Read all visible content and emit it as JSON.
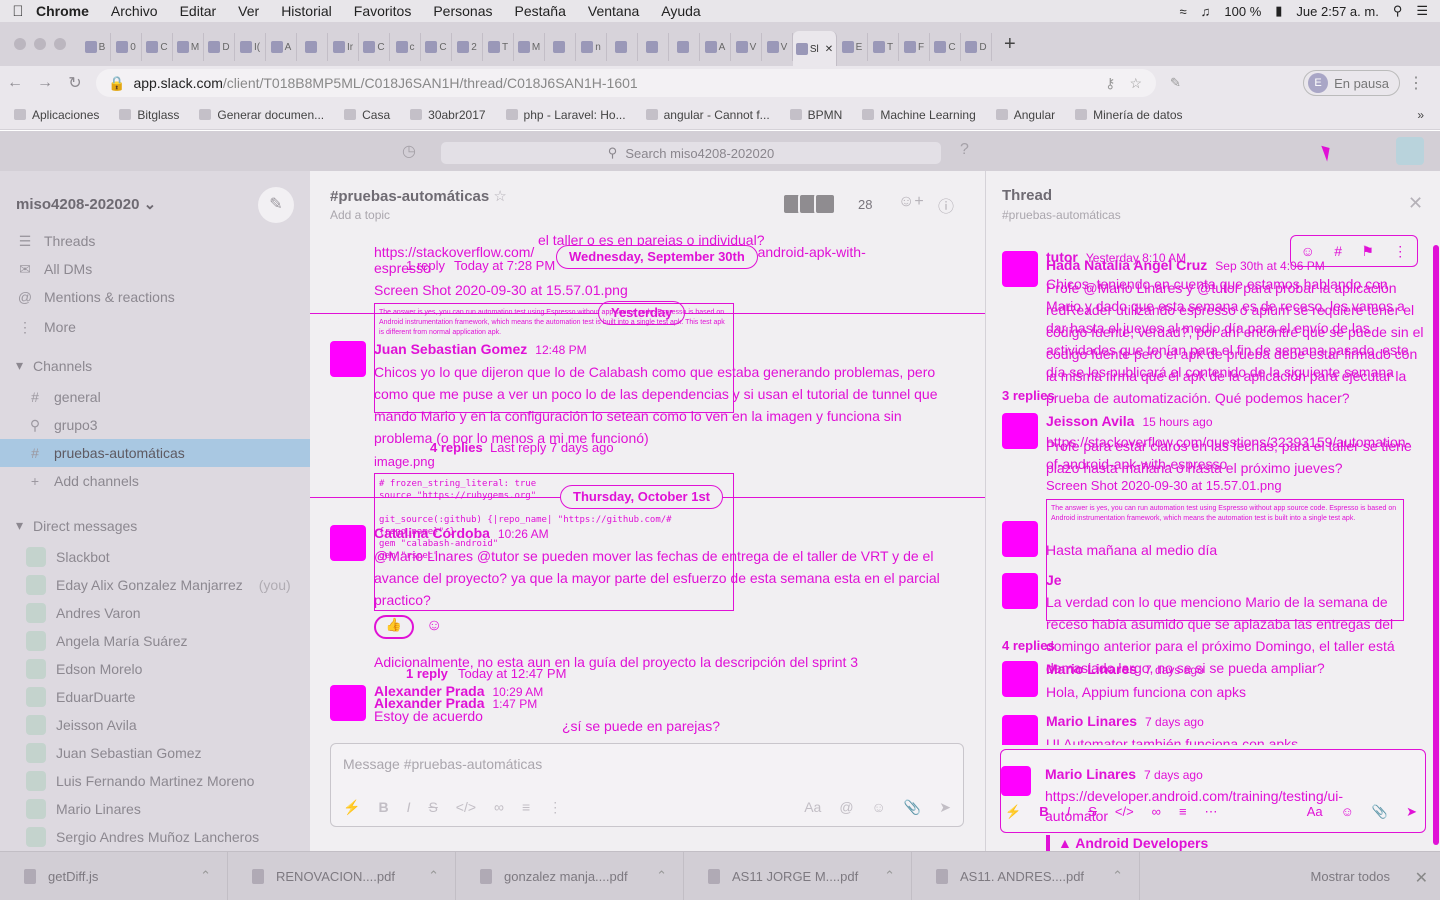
{
  "menubar": {
    "app": "Chrome",
    "items": [
      "Archivo",
      "Editar",
      "Ver",
      "Historial",
      "Favoritos",
      "Personas",
      "Pestaña",
      "Ventana",
      "Ayuda"
    ],
    "battery": "100 %",
    "clock": "Jue 2:57 a. m."
  },
  "tabs": [
    "B",
    "0",
    "C",
    "M",
    "D",
    "I(",
    "A",
    "",
    "Ir",
    "C",
    "c",
    "C",
    "2",
    "T",
    "M",
    "",
    "n",
    "",
    "",
    "",
    "A",
    "V",
    "V",
    "Sl",
    "E",
    "T",
    "F",
    "C",
    "D"
  ],
  "active_tab_index": 23,
  "toolbar": {
    "url_host": "app.slack.com",
    "url_path": "/client/T018B8MP5ML/C018J6SAN1H/thread/C018J6SAN1H-1601",
    "profile_initial": "E",
    "profile_status": "En pausa"
  },
  "bookmarks": [
    "Aplicaciones",
    "Bitglass",
    "Generar documen...",
    "Casa",
    "30abr2017",
    "php - Laravel: Ho...",
    "angular - Cannot f...",
    "BPMN",
    "Machine Learning",
    "Angular",
    "Minería de datos"
  ],
  "slack": {
    "search_placeholder": "Search miso4208-202020"
  },
  "sidebar": {
    "workspace": "miso4208-202020",
    "nav": [
      "Threads",
      "All DMs",
      "Mentions & reactions",
      "More"
    ],
    "channels_header": "Channels",
    "channels": [
      "general",
      "grupo3",
      "pruebas-automáticas"
    ],
    "add_channels": "Add channels",
    "dm_header": "Direct messages",
    "dms": [
      "Slackbot",
      "Eday Alix Gonzalez Manjarrez",
      "Andres Varon",
      "Angela María Suárez",
      "Edson Morelo",
      "EduarDuarte",
      "Jeisson Avila",
      "Juan Sebastian Gomez",
      "Luis Fernando Martinez Moreno",
      "Mario Linares",
      "Sergio Andres Muñoz Lancheros"
    ],
    "you_label": "(you)"
  },
  "channel": {
    "title": "#pruebas-automáticas",
    "topic": "Add a topic",
    "member_count": "28",
    "date_dividers": [
      "Wednesday, September 30th",
      "Yesterday",
      "Thursday, October 1st"
    ],
    "lines": {
      "l1": "el taller o es en parejas o individual?",
      "l2": "https://stackoverflow.com/",
      "l2b": "tion-of-android-apk-with-",
      "l3": "espresso",
      "reply1": "1 reply",
      "reply1time": "Today at 7:28 PM",
      "file1": "Screen Shot 2020-09-30 at 15.57.01.png",
      "jsg_name": "Juan Sebastian Gomez",
      "jsg_time": "12:48 PM",
      "jsg_text": "Chicos yo lo que dijeron que lo de Calabash como que estaba generando problemas, pero como que me puse a ver un poco lo de las dependencias y si usan el tutorial de tunnel que mando Mario y en la configuración lo setean como lo ven en la imagen y funciona sin problema (o por lo menos a mi me funcionó)",
      "replies4": "4 replies",
      "replies4time": "Last reply 7 days ago",
      "image_png": "image.png",
      "cat_name": "Catalina Córdoba",
      "cat_time": "10:26 AM",
      "cat_text": "@Mario Linares @tutor se pueden mover las fechas de entrega de el taller de VRT y de el avance del proyecto? ya que la mayor parte del esfuerzo de esta semana esta en el parcial practico?",
      "adic": "Adicionalmente, no esta aun en la guía del proyecto la descripción del sprint 3",
      "reply2": "1 reply",
      "reply2time": "Today at 12:47 PM",
      "ap_name": "Alexander Prada",
      "ap_time": "10:29 AM",
      "ap_name2": "Alexander Prada",
      "ap_time2": "1:47 PM",
      "ap_text": "Estoy de acuerdo",
      "pareja": "¿sí se puede en parejas?"
    },
    "composer_placeholder": "Message #pruebas-automáticas"
  },
  "thread": {
    "title": "Thread",
    "channel": "#pruebas-automáticas",
    "author": "Hada Natalia Angel Cruz",
    "author_time": "Sep 30th at 4:06 PM",
    "tutor": "tutor",
    "tutor_time": "Yesterday 8:10 AM",
    "t1": "Profe @Mario Linares y @tutor para probar la aplicación redReader utilizando espresso o apium se requiere tener el código fuente, verdad?, por ahí encontré que se puede sin el código fuente pero el apk de prueba debe estar firmado con la misma firma que el apk de la aplicación para ejecutar la prueba de automatización. Qué podemos hacer?",
    "ghost": "Chicos, teniendo en cuenta que estamos hablando con Mario y dado que esta semana es de receso, les vamos a dar hasta el jueves al medio día para el envío de las actividades que tenían para el fin de semana pasado, este día se les publicará el contenido de la siguiente semana",
    "replies3": "3 replies",
    "ja_name": "Jeisson Avila",
    "ja_time": "15 hours ago",
    "ja_link": "https://stackoverflow.com/questions/32393159/automation-of-android-apk-with-espresso",
    "ghost2": "Profe para estar claros en las fechas, para el taller se tiene plazo hasta mañana o hasta el próximo jueves?",
    "file": "Screen Shot 2020-09-30 at 15.57.01.png",
    "hasta": "Hasta mañana al medio día",
    "jeisson2": "Je",
    "verdad": "La verdad con lo que menciono Mario de la semana de receso había asumido que se aplazaba las entregas del domingo anterior para el próximo Domingo, el taller está demasiado largo, no se si se pueda ampliar?",
    "replies4": "4 replies",
    "ml_name": "Mario Linares",
    "ml_time": "7 days ago",
    "ml_text1": "Hola, Appium funciona con  apks",
    "ml_text2": "UI Automator también funciona con apks",
    "ml_link": "https://developer.android.com/training/testing/ui-automator",
    "android": "Android Developers"
  },
  "downloads": {
    "files": [
      "getDiff.js",
      "RENOVACION....pdf",
      "gonzalez manja....pdf",
      "AS11 JORGE M....pdf",
      "AS11. ANDRES....pdf"
    ],
    "show_all": "Mostrar todos"
  },
  "colors": {
    "accent": "#e011d6",
    "selected_channel": "#a9c8e2"
  }
}
